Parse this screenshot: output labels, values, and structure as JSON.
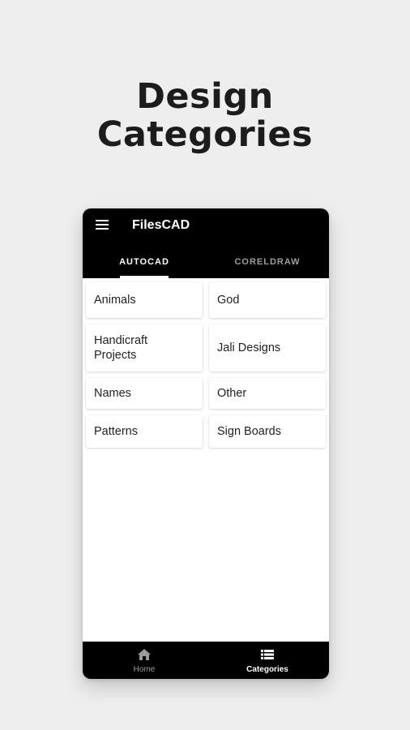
{
  "promo": {
    "title_line1": "Design",
    "title_line2": "Categories"
  },
  "appbar": {
    "title": "FilesCAD",
    "menu_icon": "menu-icon"
  },
  "tabs": [
    {
      "label": "AUTOCAD",
      "active": true
    },
    {
      "label": "CORELDRAW",
      "active": false
    }
  ],
  "categories": [
    {
      "label": "Animals"
    },
    {
      "label": "God"
    },
    {
      "label_line1": "Handicraft",
      "label_line2": "Projects"
    },
    {
      "label": "Jali Designs"
    },
    {
      "label": "Names"
    },
    {
      "label": "Other"
    },
    {
      "label": "Patterns"
    },
    {
      "label": "Sign Boards"
    }
  ],
  "bottom_nav": [
    {
      "label": "Home",
      "icon": "home-icon",
      "active": false
    },
    {
      "label": "Categories",
      "icon": "categories-icon",
      "active": true
    }
  ],
  "colors": {
    "background": "#eeeeef",
    "bar": "#000000",
    "inactive": "#9e9e9e"
  }
}
